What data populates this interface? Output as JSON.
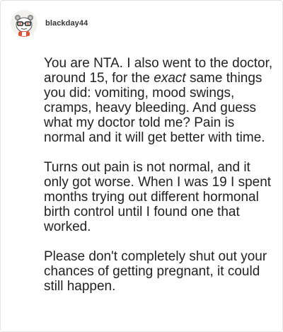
{
  "post": {
    "username": "blackday44",
    "paragraphs": [
      {
        "before": "You are NTA. I also went to the doctor, around 15, for the ",
        "emphasis": "exact",
        "after": " same things you did: vomiting, mood swings, cramps, heavy bleeding. And guess what my doctor told me? Pain is normal and it will get better with time."
      },
      {
        "text": "Turns out pain is not normal, and it only got worse. When I was 19 I spent months trying out different hormonal birth control until I found one that worked."
      },
      {
        "text": "Please don't completely shut out your chances of getting pregnant, it could still happen."
      }
    ]
  },
  "icons": {
    "avatar": "snoo-avatar-icon"
  },
  "colors": {
    "text": "#222222",
    "username": "#333333",
    "border": "#e3e3e3",
    "avatar_bg": "#f3f1ee",
    "avatar_accent": "#e0523a"
  }
}
